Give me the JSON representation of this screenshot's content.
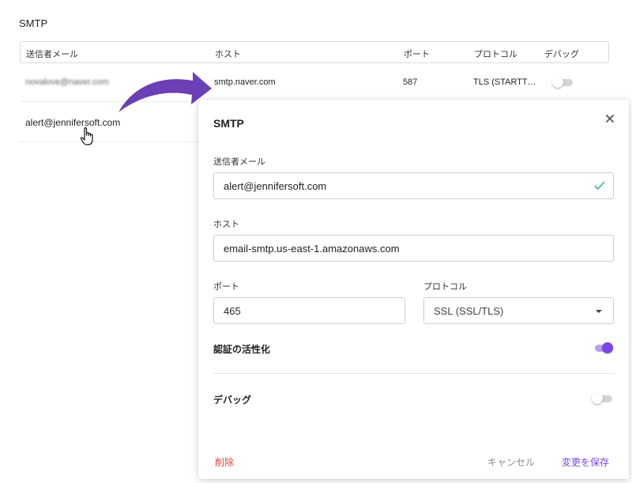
{
  "page": {
    "section_title": "SMTP"
  },
  "table": {
    "columns": [
      "送信者メール",
      "ホスト",
      "ポート",
      "プロトコル",
      "デバッグ"
    ],
    "rows": [
      {
        "sender": "novalove@naver.com",
        "host": "smtp.naver.com",
        "port": "587",
        "protocol": "TLS (STARTT…",
        "debug": false
      },
      {
        "sender": "alert@jennifersoft.com"
      }
    ]
  },
  "dialog": {
    "title": "SMTP",
    "sender_label": "送信者メール",
    "sender_value": "alert@jennifersoft.com",
    "host_label": "ホスト",
    "host_value": "email-smtp.us-east-1.amazonaws.com",
    "port_label": "ポート",
    "port_value": "465",
    "protocol_label": "プロトコル",
    "protocol_value": "SSL (SSL/TLS)",
    "auth_label": "認証の活性化",
    "auth_enabled": true,
    "debug_label": "デバッグ",
    "debug_enabled": false,
    "delete_label": "削除",
    "cancel_label": "キャンセル",
    "save_label": "変更を保存"
  },
  "colors": {
    "accent": "#7a45e6",
    "accent_light": "#b9a0f0",
    "danger": "#e0423f",
    "cancel_text": "#8a8a8a",
    "success_check": "#3fba85",
    "arrow": "#6b3fb5"
  },
  "icons": {
    "close": "close-icon",
    "check": "check-icon",
    "dropdown": "chevron-down-icon",
    "pointer": "hand-pointer-icon",
    "arrow": "curved-arrow-icon"
  }
}
